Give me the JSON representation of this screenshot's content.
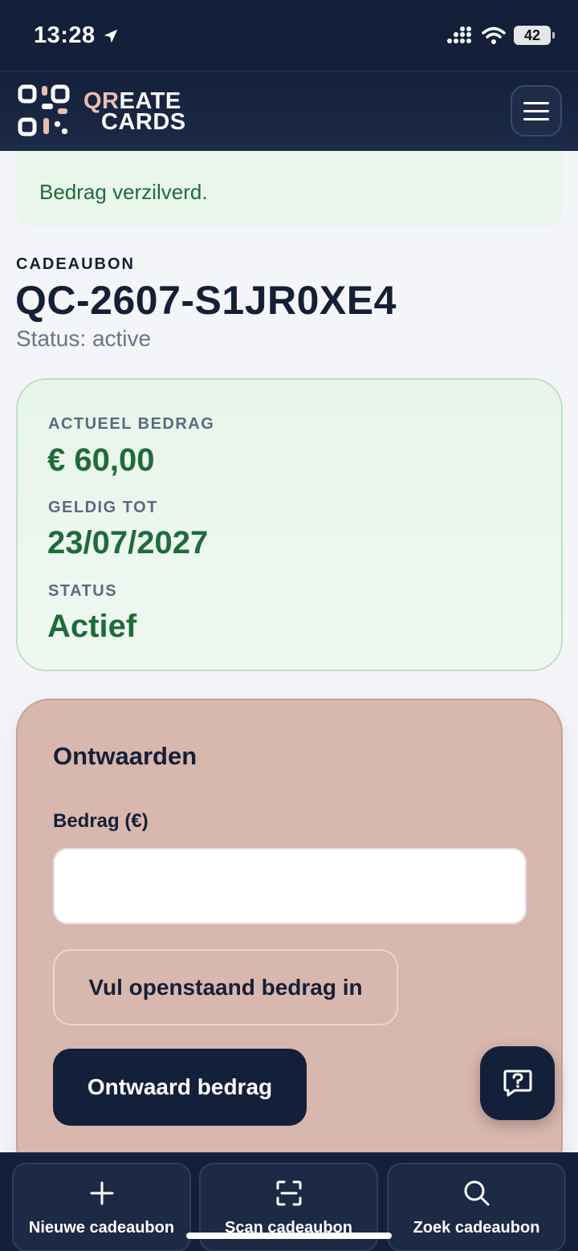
{
  "status_bar": {
    "time": "13:28",
    "battery": "42"
  },
  "header": {
    "logo_line1_a": "QR",
    "logo_line1_b": "EATE",
    "logo_line2": "CARDS"
  },
  "alert": {
    "message": "Bedrag verzilverd."
  },
  "voucher": {
    "overline": "CADEAUBON",
    "code": "QC-2607-S1JR0XE4",
    "status_line": "Status: active"
  },
  "info": {
    "amount_label": "ACTUEEL BEDRAG",
    "amount_value": "€ 60,00",
    "valid_label": "GELDIG TOT",
    "valid_value": "23/07/2027",
    "status_label": "STATUS",
    "status_value": "Actief"
  },
  "redeem": {
    "title": "Ontwaarden",
    "amount_field_label": "Bedrag (€)",
    "amount_value": "",
    "fill_button": "Vul openstaand bedrag in",
    "redeem_button": "Ontwaard bedrag"
  },
  "bottom_nav": {
    "new": "Nieuwe cadeaubon",
    "scan": "Scan cadeaubon",
    "search": "Zoek cadeaubon"
  },
  "colors": {
    "navy": "#14203a",
    "success_green": "#1f6b3a",
    "success_bg": "#e9f6ec",
    "redeem_bg": "#d8b7ae"
  }
}
